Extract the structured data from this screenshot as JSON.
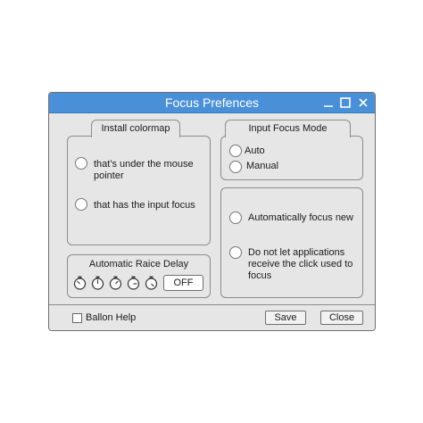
{
  "window": {
    "title": "Focus Prefences",
    "controls": {
      "minimize": "minimize-icon",
      "maximize": "maximize-icon",
      "close": "close-icon"
    }
  },
  "colormap": {
    "title": "Install colormap",
    "options": [
      {
        "label": "that's under the mouse pointer",
        "selected": false
      },
      {
        "label": "that has the input focus",
        "selected": false
      }
    ]
  },
  "input_focus": {
    "title": "Input Focus Mode",
    "options": [
      {
        "label": "Auto",
        "selected": false
      },
      {
        "label": "Manual",
        "selected": false
      }
    ]
  },
  "auto_focus": {
    "options": [
      {
        "label": "Automatically focus new",
        "selected": false
      },
      {
        "label": "Do not let applications receive the click used to focus",
        "selected": false
      }
    ]
  },
  "raise_delay": {
    "title": "Automatic Raice Delay",
    "timer_icons": [
      "timer-icon",
      "timer-icon",
      "timer-icon",
      "timer-icon",
      "timer-icon"
    ],
    "value": "OFF"
  },
  "footer": {
    "balloon_help": {
      "label": "Ballon Help",
      "checked": false
    },
    "save_label": "Save",
    "close_label": "Close"
  },
  "colors": {
    "titlebar": "#4a90d9",
    "window_bg": "#e6e6e6",
    "border": "#8c8c8c"
  }
}
